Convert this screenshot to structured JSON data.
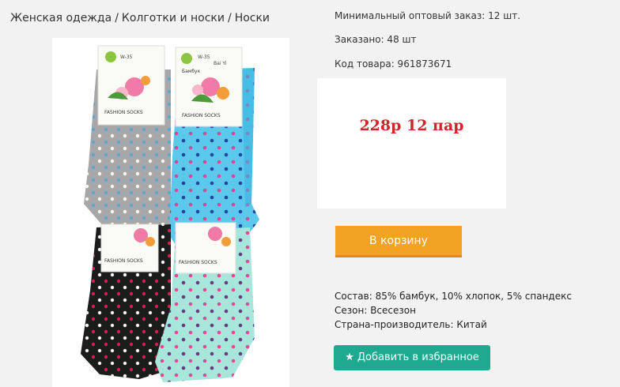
{
  "breadcrumb": {
    "items": [
      "Женская одежда",
      "Колготки и носки",
      "Носки"
    ],
    "separator": "/"
  },
  "product": {
    "min_order": "Минимальный оптовый заказ: 12 шт.",
    "ordered": "Заказано: 48 шт",
    "code": "Код товара: 961873671",
    "price": "228р 12 пар",
    "image": {
      "label_brand": "Бамбук",
      "label_model": "W-35",
      "label_logo": "Bai Yi",
      "label_line": "FASHION SOCKS"
    }
  },
  "actions": {
    "cart_label": "В корзину",
    "favorite_label": "Добавить в избранное",
    "favorite_icon": "star-icon"
  },
  "specs": {
    "composition": "Состав: 85% бамбук, 10% хлопок, 5% спандекс",
    "season": "Сезон: Всесезон",
    "country": "Страна-производитель: Китай"
  },
  "colors": {
    "price": "#d0252a",
    "cart_button": "#f3a324",
    "favorite_button": "#1eaa90",
    "sock_grey": "#a7a7aa",
    "sock_blue": "#5bc8ec",
    "sock_black": "#1c1c1c",
    "sock_mint": "#a8e6dc"
  }
}
